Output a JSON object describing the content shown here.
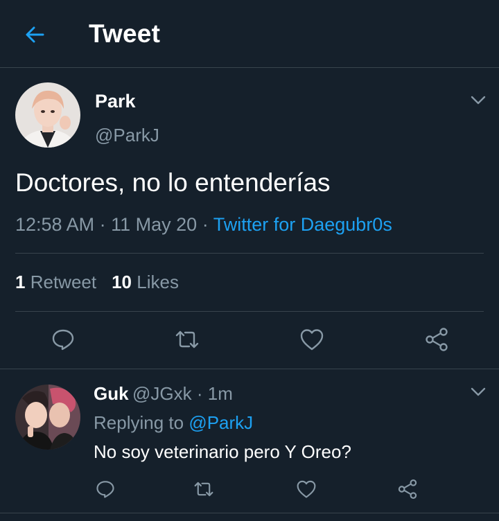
{
  "header": {
    "title": "Tweet",
    "back_icon": "arrow-left-icon"
  },
  "colors": {
    "background": "#15202b",
    "accent": "#1da1f2",
    "muted": "#8899a6",
    "divider": "#38444d"
  },
  "tweet": {
    "author_name": "Park",
    "author_handle": "@ParkJ",
    "text": "Doctores, no lo entenderías",
    "time": "12:58 AM",
    "date": "11 May 20",
    "separator": "·",
    "source": "Twitter for Daegubr0s",
    "retweets_count": "1",
    "retweets_label": "Retweet",
    "likes_count": "10",
    "likes_label": "Likes",
    "actions": [
      "reply-icon",
      "retweet-icon",
      "like-icon",
      "share-icon"
    ]
  },
  "reply": {
    "author_name": "Guk",
    "author_handle": "@JGxk",
    "separator": "·",
    "age": "1m",
    "replying_prefix": "Replying to",
    "replying_mention": "@ParkJ",
    "text": "No soy veterinario pero Y Oreo?",
    "actions": [
      "reply-icon",
      "retweet-icon",
      "like-icon",
      "share-icon"
    ]
  }
}
